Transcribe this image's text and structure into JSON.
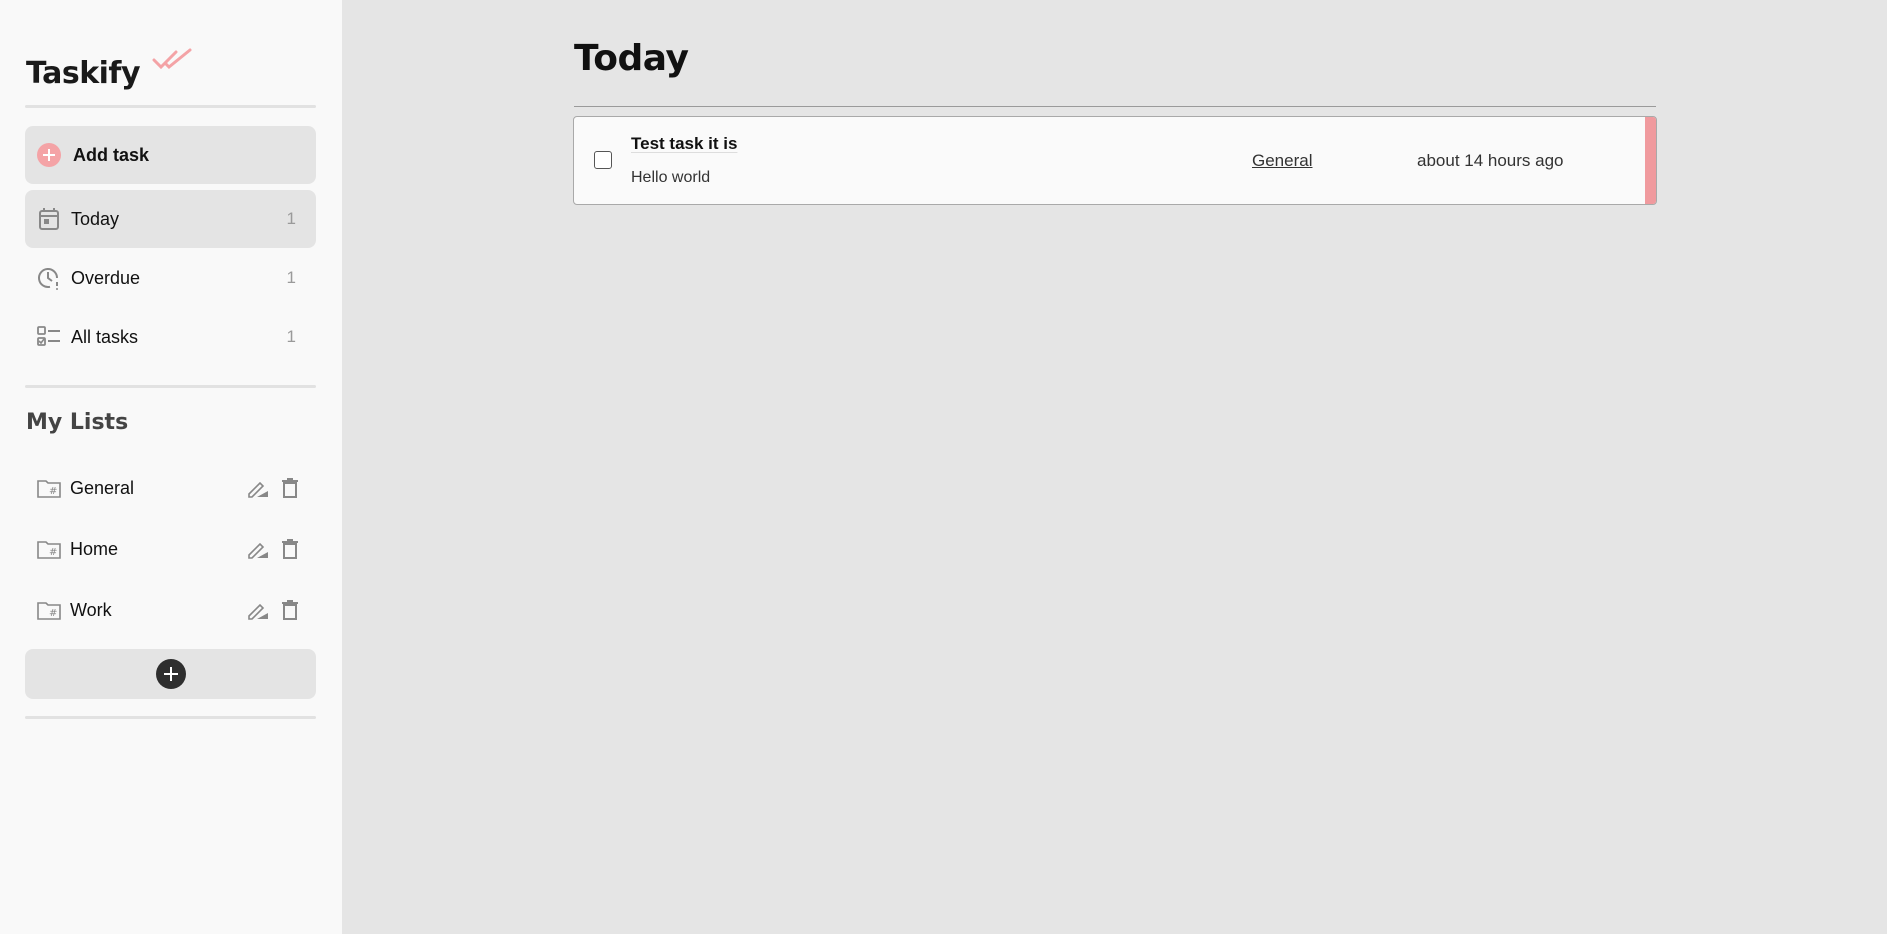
{
  "app": {
    "title": "Taskify"
  },
  "sidebar": {
    "add_task_label": "Add task",
    "nav": [
      {
        "label": "Today",
        "count": "1",
        "icon": "calendar-icon",
        "active": true
      },
      {
        "label": "Overdue",
        "count": "1",
        "icon": "clock-alert-icon",
        "active": false
      },
      {
        "label": "All tasks",
        "count": "1",
        "icon": "checklist-icon",
        "active": false
      }
    ],
    "lists_title": "My Lists",
    "lists": [
      {
        "label": "General",
        "icon": "folder-hash-icon"
      },
      {
        "label": "Home",
        "icon": "folder-hash-icon"
      },
      {
        "label": "Work",
        "icon": "folder-hash-icon"
      }
    ]
  },
  "main": {
    "title": "Today",
    "tasks": [
      {
        "title": "Test task it is",
        "description": "Hello world",
        "list": "General",
        "time": "about 14 hours ago",
        "completed": false,
        "priority_color": "#f09a9e"
      }
    ]
  },
  "colors": {
    "accent": "#f4a3a6",
    "sidebar_bg": "#f9f9f9",
    "main_bg": "#e5e5e5"
  }
}
